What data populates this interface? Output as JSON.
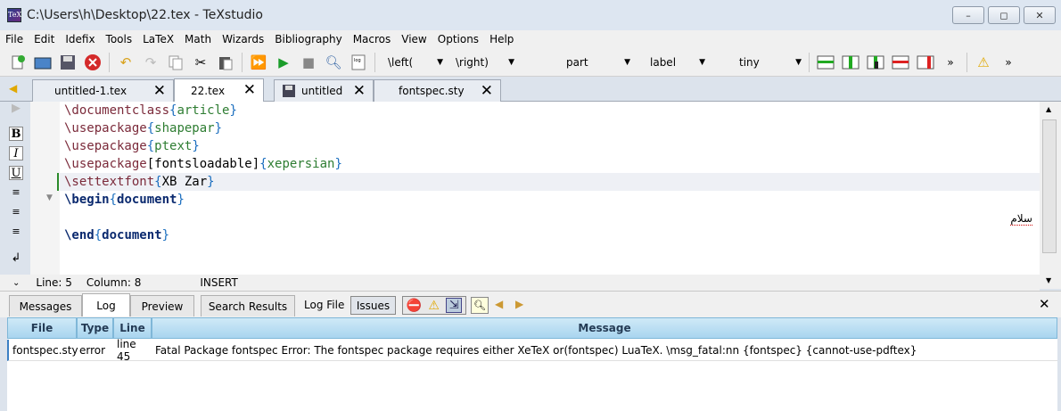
{
  "window": {
    "title": "C:\\Users\\h\\Desktop\\22.tex - TeXstudio",
    "app_icon_text": "TeX",
    "controls": {
      "minimize": "–",
      "maximize": "◻",
      "close": "✕"
    }
  },
  "menu": [
    "File",
    "Edit",
    "Idefix",
    "Tools",
    "LaTeX",
    "Math",
    "Wizards",
    "Bibliography",
    "Macros",
    "View",
    "Options",
    "Help"
  ],
  "toolbar": {
    "left_delim": "\\left(",
    "right_delim": "\\right)",
    "section": "part",
    "ref": "label",
    "size": "tiny",
    "overflow1": "»",
    "overflow2": "»"
  },
  "tabs": [
    {
      "label": "untitled-1.tex",
      "close": "✕"
    },
    {
      "label": "22.tex",
      "close": "✕"
    },
    {
      "label": "untitled",
      "close": "✕"
    },
    {
      "label": "fontspec.sty",
      "close": "✕"
    }
  ],
  "editor": {
    "lines": [
      {
        "cmd": "\\documentclass",
        "open": "{",
        "arg": "article",
        "close": "}"
      },
      {
        "cmd": "\\usepackage",
        "open": "{",
        "arg": "shapepar",
        "close": "}"
      },
      {
        "cmd": "\\usepackage",
        "open": "{",
        "arg": "ptext",
        "close": "}"
      },
      {
        "cmd": "\\usepackage",
        "opt": "[fontsloadable]",
        "open": "{",
        "arg": "xepersian",
        "close": "}"
      },
      {
        "cmd": "\\settextfont",
        "open": "{",
        "arg": "XB Zar",
        "close": "}"
      },
      {
        "cmd": "\\begin",
        "open": "{",
        "arg": "document",
        "close": "}"
      },
      {
        "cmd": "",
        "arg": ""
      },
      {
        "cmd": "\\end",
        "open": "{",
        "arg": "document",
        "close": "}"
      }
    ],
    "rtl_text": "سلام"
  },
  "status": {
    "line": "Line: 5",
    "column": "Column: 8",
    "mode": "INSERT"
  },
  "panel": {
    "tabs": [
      "Messages",
      "Log",
      "Preview",
      "Search Results"
    ],
    "log_file_label": "Log File",
    "issues_label": "Issues",
    "close": "✕"
  },
  "log_table": {
    "columns": [
      "File",
      "Type",
      "Line",
      "Message"
    ],
    "rows": [
      {
        "file": "fontspec.sty",
        "type": "error",
        "line": "line 45",
        "message": "Fatal Package fontspec Error: The fontspec package requires either XeTeX or(fontspec) LuaTeX. \\msg_fatal:nn {fontspec} {cannot-use-pdftex}"
      }
    ]
  }
}
